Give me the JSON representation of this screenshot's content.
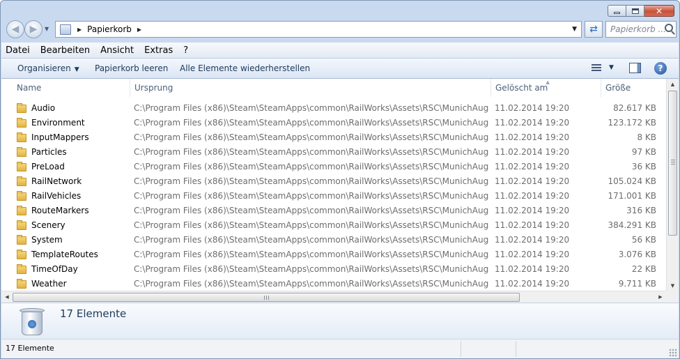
{
  "window": {
    "caption": {
      "close_glyph": "✕"
    }
  },
  "nav": {
    "back_glyph": "◀",
    "forward_glyph": "▶",
    "address": {
      "location": "Papierkorb"
    },
    "search_placeholder": "Papierkorb ..."
  },
  "menubar": {
    "items": [
      "Datei",
      "Bearbeiten",
      "Ansicht",
      "Extras",
      "?"
    ]
  },
  "toolbar": {
    "organize_label": "Organisieren",
    "empty_bin_label": "Papierkorb leeren",
    "restore_all_label": "Alle Elemente wiederherstellen",
    "help_glyph": "?"
  },
  "columns": {
    "name": "Name",
    "origin": "Ursprung",
    "deleted": "Gelöscht am",
    "size": "Größe"
  },
  "files": [
    {
      "name": "Audio",
      "origin": "C:\\Program Files (x86)\\Steam\\SteamApps\\common\\RailWorks\\Assets\\RSC\\MunichAugsburg",
      "deleted": "11.02.2014 19:20",
      "size": "82.617 KB"
    },
    {
      "name": "Environment",
      "origin": "C:\\Program Files (x86)\\Steam\\SteamApps\\common\\RailWorks\\Assets\\RSC\\MunichAugsburg",
      "deleted": "11.02.2014 19:20",
      "size": "123.172 KB"
    },
    {
      "name": "InputMappers",
      "origin": "C:\\Program Files (x86)\\Steam\\SteamApps\\common\\RailWorks\\Assets\\RSC\\MunichAugsburg",
      "deleted": "11.02.2014 19:20",
      "size": "8 KB"
    },
    {
      "name": "Particles",
      "origin": "C:\\Program Files (x86)\\Steam\\SteamApps\\common\\RailWorks\\Assets\\RSC\\MunichAugsburg",
      "deleted": "11.02.2014 19:20",
      "size": "97 KB"
    },
    {
      "name": "PreLoad",
      "origin": "C:\\Program Files (x86)\\Steam\\SteamApps\\common\\RailWorks\\Assets\\RSC\\MunichAugsburg",
      "deleted": "11.02.2014 19:20",
      "size": "36 KB"
    },
    {
      "name": "RailNetwork",
      "origin": "C:\\Program Files (x86)\\Steam\\SteamApps\\common\\RailWorks\\Assets\\RSC\\MunichAugsburg",
      "deleted": "11.02.2014 19:20",
      "size": "105.024 KB"
    },
    {
      "name": "RailVehicles",
      "origin": "C:\\Program Files (x86)\\Steam\\SteamApps\\common\\RailWorks\\Assets\\RSC\\MunichAugsburg",
      "deleted": "11.02.2014 19:20",
      "size": "171.001 KB"
    },
    {
      "name": "RouteMarkers",
      "origin": "C:\\Program Files (x86)\\Steam\\SteamApps\\common\\RailWorks\\Assets\\RSC\\MunichAugsburg",
      "deleted": "11.02.2014 19:20",
      "size": "316 KB"
    },
    {
      "name": "Scenery",
      "origin": "C:\\Program Files (x86)\\Steam\\SteamApps\\common\\RailWorks\\Assets\\RSC\\MunichAugsburg",
      "deleted": "11.02.2014 19:20",
      "size": "384.291 KB"
    },
    {
      "name": "System",
      "origin": "C:\\Program Files (x86)\\Steam\\SteamApps\\common\\RailWorks\\Assets\\RSC\\MunichAugsburg",
      "deleted": "11.02.2014 19:20",
      "size": "56 KB"
    },
    {
      "name": "TemplateRoutes",
      "origin": "C:\\Program Files (x86)\\Steam\\SteamApps\\common\\RailWorks\\Assets\\RSC\\MunichAugsburg",
      "deleted": "11.02.2014 19:20",
      "size": "3.076 KB"
    },
    {
      "name": "TimeOfDay",
      "origin": "C:\\Program Files (x86)\\Steam\\SteamApps\\common\\RailWorks\\Assets\\RSC\\MunichAugsburg",
      "deleted": "11.02.2014 19:20",
      "size": "22 KB"
    },
    {
      "name": "Weather",
      "origin": "C:\\Program Files (x86)\\Steam\\SteamApps\\common\\RailWorks\\Assets\\RSC\\MunichAugsburg",
      "deleted": "11.02.2014 19:20",
      "size": "9.711 KB"
    }
  ],
  "details": {
    "count_text": "17 Elemente"
  },
  "status": {
    "text": "17 Elemente"
  },
  "icons": {
    "folder": "folder-icon",
    "recycle_bin": "recycle-bin-icon",
    "view": "view-options-icon",
    "preview_pane": "preview-pane-icon",
    "help": "help-icon"
  },
  "colors": {
    "frame": "#c9daf0",
    "toolbar_text": "#1e395b",
    "secondary_text": "#6d6d6d",
    "close_button": "#c9503a"
  }
}
